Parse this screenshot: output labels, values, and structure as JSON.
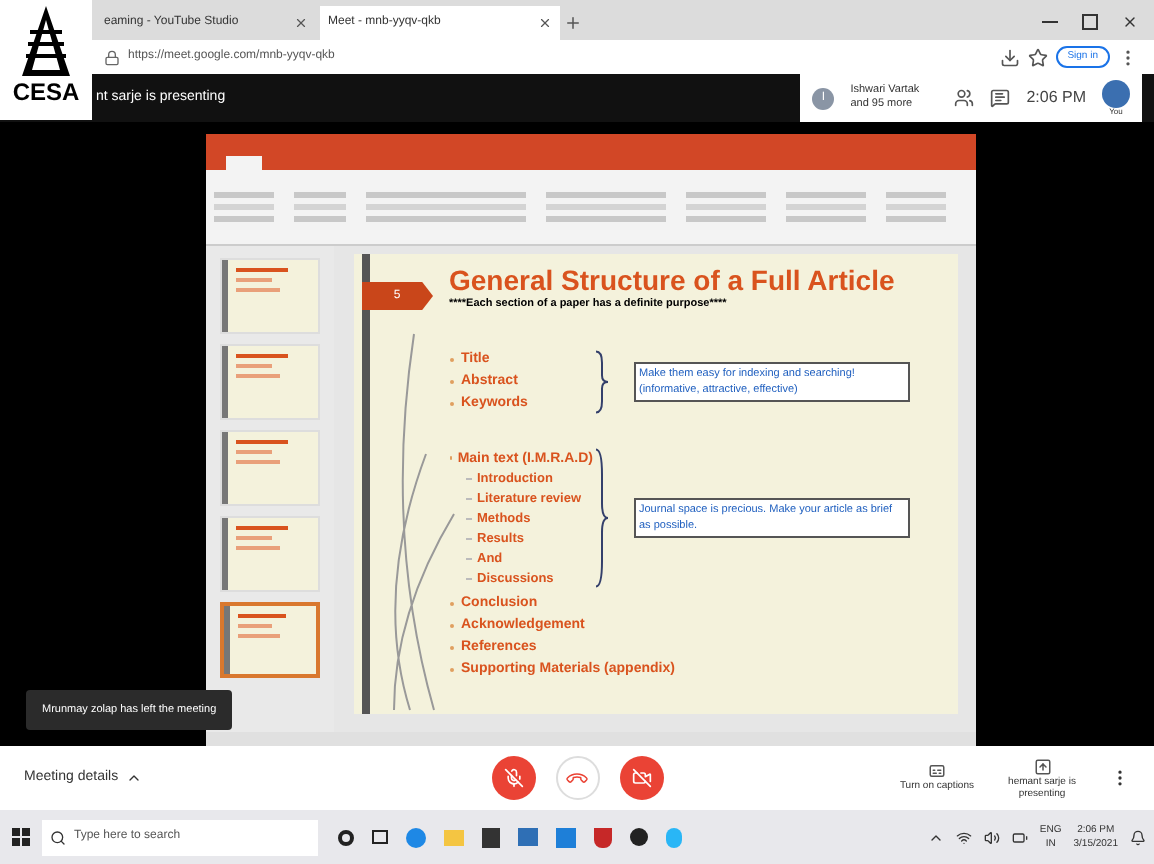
{
  "browser": {
    "tabs": [
      {
        "label": "eaming - YouTube Studio",
        "selected": false
      },
      {
        "label": "Meet - mnb-yyqv-qkb",
        "selected": true
      }
    ],
    "url": "https://meet.google.com/mnb-yyqv-qkb",
    "sign_in": "Sign in"
  },
  "logo": {
    "text": "CESA"
  },
  "meet": {
    "presenting_banner": "nt sarje is presenting",
    "participants": "Ishwari Vartak and 95 more",
    "participant_initial": "I",
    "time": "2:06 PM",
    "self_label": "You",
    "toast": "Mrunmay zolap has left the meeting",
    "meeting_details": "Meeting details",
    "captions": "Turn on captions",
    "presenter": "hemant sarje is presenting",
    "mic_on": false,
    "camera_on": false
  },
  "thumbnails": [
    {
      "selected": false
    },
    {
      "selected": false
    },
    {
      "selected": false
    },
    {
      "selected": false
    },
    {
      "selected": true
    }
  ],
  "slide": {
    "number": "5",
    "title": "General Structure of a Full Article",
    "subtitle": "****Each section of a paper has a definite purpose****",
    "groups": [
      {
        "items": [
          {
            "text": "Title",
            "kind": "bullet"
          },
          {
            "text": "Abstract",
            "kind": "bullet"
          },
          {
            "text": "Keywords",
            "kind": "bullet"
          }
        ],
        "note": "Make them easy for indexing and searching! (informative, attractive, effective)"
      },
      {
        "items": [
          {
            "text": "Main text (I.M.R.A.D)",
            "kind": "bullet"
          },
          {
            "text": "Introduction",
            "kind": "sub"
          },
          {
            "text": "Literature review",
            "kind": "sub"
          },
          {
            "text": "Methods",
            "kind": "sub"
          },
          {
            "text": "Results",
            "kind": "sub"
          },
          {
            "text": "And",
            "kind": "sub"
          },
          {
            "text": "Discussions",
            "kind": "sub"
          }
        ],
        "note": "Journal space is precious. Make your article as brief as possible."
      }
    ],
    "items": [
      {
        "text": "Conclusion",
        "kind": "bullet"
      },
      {
        "text": "Acknowledgement",
        "kind": "bullet"
      },
      {
        "text": "References",
        "kind": "bullet"
      },
      {
        "text": "Supporting Materials (appendix)",
        "kind": "bullet"
      }
    ]
  },
  "taskbar": {
    "search_placeholder": "Type here to search",
    "language": "ENG",
    "region": "IN",
    "time": "2:06 PM",
    "date": "3/15/2021"
  }
}
